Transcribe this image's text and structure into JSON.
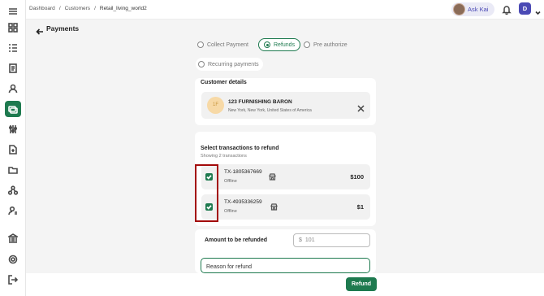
{
  "breadcrumb": [
    {
      "label": "Dashboard"
    },
    {
      "label": "Customers"
    },
    {
      "label": "Retail_living_world2"
    }
  ],
  "breadcrumb_separator": "/",
  "header": {
    "ask_kai_label": "Ask Kai",
    "user_initial": "D",
    "page_title": "Payments"
  },
  "payment_types": {
    "collect": "Collect Payment",
    "refunds": "Refunds",
    "preauth": "Pre authorize",
    "recurring": "Recurring payments",
    "selected": "Refunds"
  },
  "customer": {
    "section_title": "Customer details",
    "initials": "1F",
    "name": "123 FURNISHING BARON",
    "address": "New York, New York, United States of America"
  },
  "transactions": {
    "section_title": "Select transactions to refund",
    "subtitle": "Showing 2 transactions",
    "items": [
      {
        "id": "TX-1805367669",
        "mode": "Offline",
        "amount": "$100",
        "checked": true
      },
      {
        "id": "TX-4935336259",
        "mode": "Offline",
        "amount": "$1",
        "checked": true
      }
    ]
  },
  "amount": {
    "label": "Amount to be refunded",
    "currency": "$",
    "placeholder": "101"
  },
  "reason": {
    "placeholder": "Reason for refund"
  },
  "footer": {
    "refund_label": "Refund"
  },
  "colors": {
    "accent": "#1e7a4f",
    "highlight": "#a30a0a",
    "kai": "#4a49b4"
  },
  "sidebar_icons": [
    "menu-icon",
    "dashboard-icon",
    "list-icon",
    "document-icon",
    "person-icon",
    "payments-icon",
    "settings-sliders-icon",
    "file-upload-icon",
    "folder-icon",
    "network-icon",
    "user-manage-icon",
    "bank-icon",
    "gear-icon",
    "logout-icon"
  ]
}
